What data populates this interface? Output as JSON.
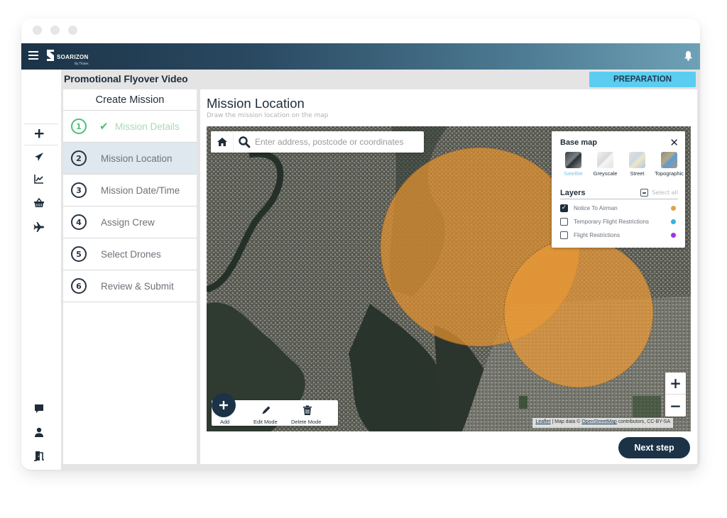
{
  "app": {
    "brand": "SOARIZON",
    "brand_sub": "By Thales"
  },
  "header": {
    "mission_name": "Promotional Flyover Video",
    "status": "PREPARATION",
    "status_color": "#5bcdf0"
  },
  "leftnav": {
    "top_items": [
      {
        "icon": "plus-icon"
      },
      {
        "icon": "paper-plane-icon"
      },
      {
        "icon": "chart-line-icon"
      },
      {
        "icon": "basket-icon"
      },
      {
        "icon": "airplane-icon"
      }
    ],
    "bottom_items": [
      {
        "icon": "chat-icon"
      },
      {
        "icon": "user-icon"
      },
      {
        "icon": "logout-door-icon"
      }
    ]
  },
  "steps": {
    "title": "Create Mission",
    "items": [
      {
        "num": "1",
        "label": "Mission Details",
        "state": "done",
        "check": "✔"
      },
      {
        "num": "2",
        "label": "Mission Location",
        "state": "active"
      },
      {
        "num": "3",
        "label": "Mission Date/Time",
        "state": "todo"
      },
      {
        "num": "4",
        "label": "Assign Crew",
        "state": "todo"
      },
      {
        "num": "5",
        "label": "Select Drones",
        "state": "todo"
      },
      {
        "num": "6",
        "label": "Review & Submit",
        "state": "todo"
      }
    ]
  },
  "main": {
    "title": "Mission Location",
    "subtitle": "Draw the mission location on the map"
  },
  "map": {
    "search_placeholder": "Enter address, postcode or coordinates",
    "basemap": {
      "title": "Base map",
      "close": "✕",
      "options": [
        {
          "label": "Satellite",
          "selected": true
        },
        {
          "label": "Greyscale",
          "selected": false
        },
        {
          "label": "Street",
          "selected": false
        },
        {
          "label": "Topographic",
          "selected": false
        }
      ]
    },
    "layers": {
      "title": "Layers",
      "select_all": "Select all",
      "items": [
        {
          "label": "Notice To Airman",
          "checked": true,
          "color": "#e3a148"
        },
        {
          "label": "Temporary Flight Restrictions",
          "checked": false,
          "color": "#34b4d8"
        },
        {
          "label": "Flight Restrictions",
          "checked": false,
          "color": "#9b37e0"
        }
      ]
    },
    "zoom_in": "+",
    "zoom_out": "−",
    "attribution": {
      "leaflet": "Leaflet",
      "middle": " | Map data © ",
      "osm": "OpenStreetMap",
      "end": " contributors, CC-BY-SA"
    },
    "overlay_color": "#e5932f",
    "tools": {
      "add": "Add",
      "edit": "Edit Mode",
      "delete": "Delete Mode"
    }
  },
  "footer": {
    "next_label": "Next step"
  }
}
